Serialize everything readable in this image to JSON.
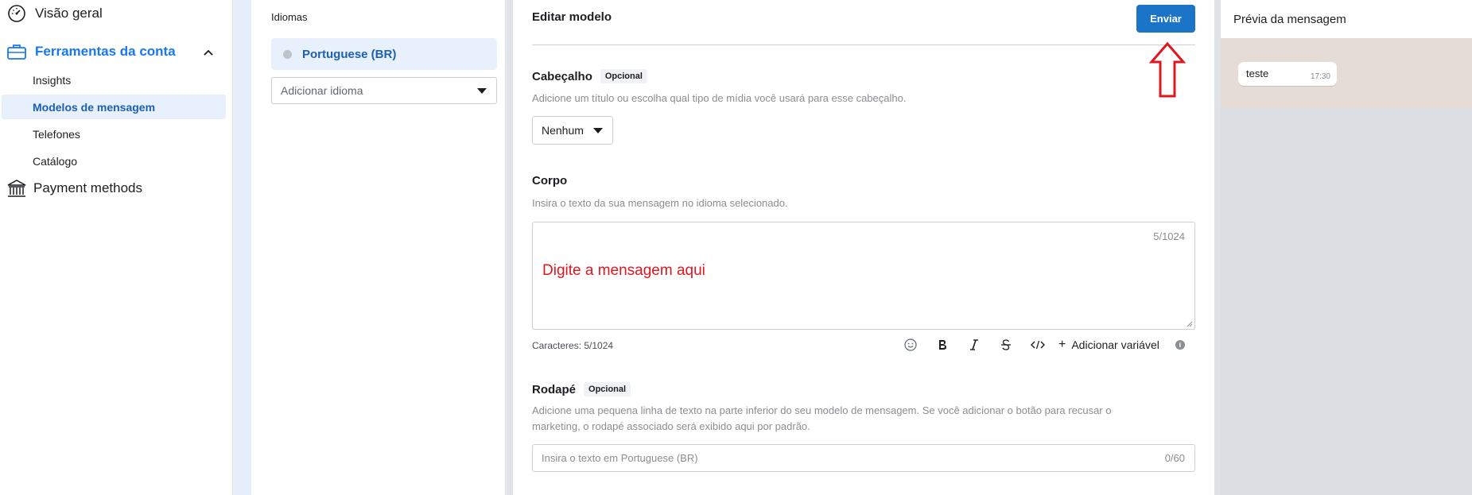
{
  "sidebar": {
    "overview": "Visão geral",
    "group_label": "Ferramentas da conta",
    "items": [
      {
        "label": "Insights"
      },
      {
        "label": "Modelos de mensagem"
      },
      {
        "label": "Telefones"
      },
      {
        "label": "Catálogo"
      }
    ],
    "payment": "Payment methods"
  },
  "languages": {
    "title": "Idiomas",
    "selected": "Portuguese (BR)",
    "add_placeholder": "Adicionar idioma"
  },
  "editor": {
    "title": "Editar modelo",
    "send_label": "Enviar",
    "header": {
      "title": "Cabeçalho",
      "badge": "Opcional",
      "description": "Adicione um título ou escolha qual tipo de mídia você usará para esse cabeçalho.",
      "select_value": "Nenhum"
    },
    "body": {
      "title": "Corpo",
      "description": "Insira o texto da sua mensagem no idioma selecionado.",
      "counter": "5/1024",
      "annotation": "Digite a mensagem aqui",
      "chars_label": "Caracteres: 5/1024",
      "add_variable": "Adicionar variável"
    },
    "footer": {
      "title": "Rodapé",
      "badge": "Opcional",
      "description_line1": "Adicione uma pequena linha de texto na parte inferior do seu modelo de mensagem. Se você adicionar o botão para recusar o",
      "description_line2": "marketing, o rodapé associado será exibido aqui por padrão.",
      "placeholder": "Insira o texto em Portuguese (BR)",
      "counter": "0/60"
    }
  },
  "preview": {
    "title": "Prévia da mensagem",
    "message": "teste",
    "time": "17:30"
  },
  "colors": {
    "accent": "#1b74c8",
    "annotation_red": "#e0161f"
  }
}
